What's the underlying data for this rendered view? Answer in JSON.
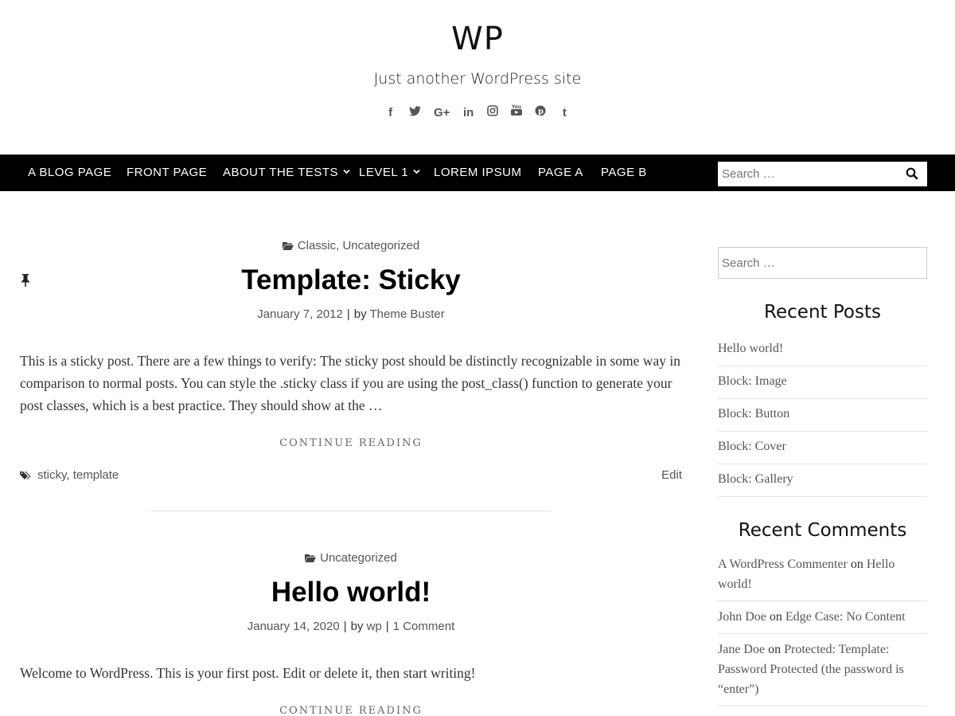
{
  "site": {
    "title": "WP",
    "tagline": "Just another WordPress site"
  },
  "social": [
    {
      "icon": "facebook-icon",
      "glyph": "f"
    },
    {
      "icon": "twitter-icon",
      "glyph": "🐦"
    },
    {
      "icon": "google-plus-icon",
      "glyph": "G+"
    },
    {
      "icon": "linkedin-icon",
      "glyph": "in"
    },
    {
      "icon": "instagram-icon",
      "glyph": "◎"
    },
    {
      "icon": "youtube-icon",
      "glyph": "▶"
    },
    {
      "icon": "pinterest-icon",
      "glyph": "℗"
    },
    {
      "icon": "tumblr-icon",
      "glyph": "t"
    }
  ],
  "nav": {
    "items": [
      {
        "label": "A BLOG PAGE"
      },
      {
        "label": "FRONT PAGE"
      },
      {
        "label": "ABOUT THE TESTS",
        "dropdown": true
      },
      {
        "label": "LEVEL 1",
        "dropdown": true
      },
      {
        "label": "LOREM IPSUM"
      },
      {
        "label": "PAGE A"
      },
      {
        "label": "PAGE B"
      }
    ],
    "search_placeholder": "Search …"
  },
  "posts": [
    {
      "categories": [
        "Classic",
        "Uncategorized"
      ],
      "title": "Template: Sticky",
      "date": "January 7, 2012",
      "by": "by",
      "author": "Theme Buster",
      "excerpt": "This is a sticky post. There are a few things to verify: The sticky post should be distinctly recognizable in some way in comparison to normal posts. You can style the .sticky class if you are using the post_class() function to generate your post classes, which is a best practice. They should show at the …",
      "continue": "CONTINUE READING",
      "tags": [
        "sticky",
        "template"
      ],
      "edit": "Edit"
    },
    {
      "categories": [
        "Uncategorized"
      ],
      "title": "Hello world!",
      "date": "January 14, 2020",
      "by": "by",
      "author": "wp",
      "comments": "1 Comment",
      "excerpt": "Welcome to WordPress. This is your first post. Edit or delete it, then start writing!",
      "continue": "CONTINUE READING"
    }
  ],
  "sidebar": {
    "search_placeholder": "Search …",
    "recent_posts_title": "Recent Posts",
    "recent_posts": [
      "Hello world!",
      "Block: Image",
      "Block: Button",
      "Block: Cover",
      "Block: Gallery"
    ],
    "recent_comments_title": "Recent Comments",
    "recent_comments": [
      {
        "author": "A WordPress Commenter",
        "on": "on",
        "post": "Hello world!"
      },
      {
        "author": "John Doe",
        "on": "on",
        "post": "Edge Case: No Content"
      },
      {
        "author": "Jane Doe",
        "on": "on",
        "post": "Protected: Template: Password Protected (the password is “enter”)"
      }
    ]
  }
}
